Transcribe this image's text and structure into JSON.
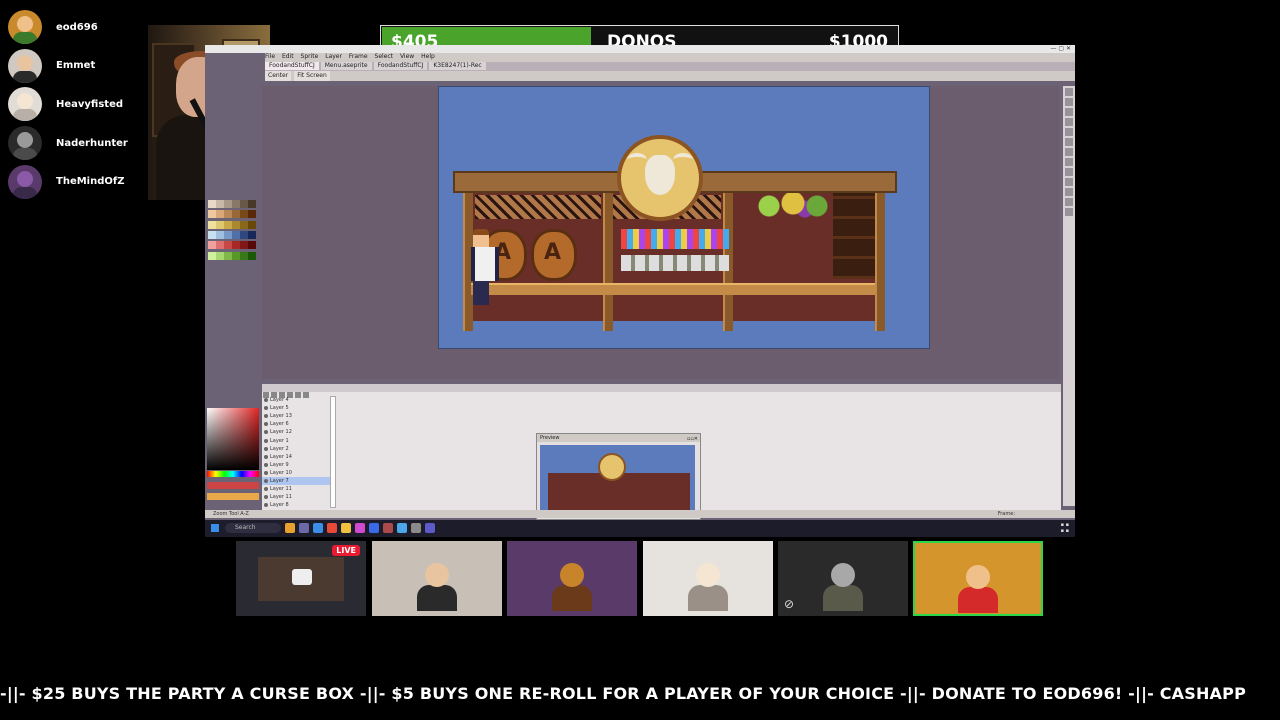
{
  "participants": [
    {
      "name": "eod696",
      "avatar": "avatar-eod696",
      "color": "#c88a2c",
      "face": "#f0c08a",
      "body": "#3a7a2a"
    },
    {
      "name": "Emmet",
      "avatar": "avatar-emmet",
      "color": "#cfc9c2",
      "face": "#e8c4a0",
      "body": "#2a2a2a"
    },
    {
      "name": "Heavyfisted",
      "avatar": "avatar-heavyfisted",
      "color": "#e2dcd6",
      "face": "#f4e6d2",
      "body": "#b8b0a8"
    },
    {
      "name": "Naderhunter",
      "avatar": "avatar-naderhunter",
      "color": "#2a2a2a",
      "face": "#9a9a9a",
      "body": "#4a4a4a"
    },
    {
      "name": "TheMindOfZ",
      "avatar": "avatar-themindofz",
      "color": "#5a3a6a",
      "face": "#8a5aa8",
      "body": "#3a2a4a"
    }
  ],
  "donations": {
    "current": "$405",
    "label": "DONOS",
    "goal": "$1000",
    "progress": 0.405,
    "fill_color": "#4aa32a"
  },
  "aseprite": {
    "tabs": [
      {
        "label": "FoodandStuffCJ"
      },
      {
        "label": "Menu.aseprite"
      },
      {
        "label": "FoodandStuffCJ"
      },
      {
        "label": "K3E8247(1)-Rec"
      }
    ],
    "toolbar": [
      "Center",
      "Fit Screen"
    ],
    "layers": [
      "Layer 4",
      "Layer 5",
      "Layer 13",
      "Layer 6",
      "Layer 12",
      "Layer 1",
      "Layer 2",
      "Layer 14",
      "Layer 9",
      "Layer 10",
      "Layer 7",
      "Layer 11",
      "Layer 11",
      "Layer 8"
    ],
    "preview_title": "Preview",
    "status_zoom": "Zoom Tool A-Z",
    "frame_label": "Frame:",
    "search_label": "Search"
  },
  "tiles": [
    {
      "id": "streamer-preview",
      "bg": "#2a2a32",
      "live": "LIVE"
    },
    {
      "id": "emmet",
      "bg": "#c8c0b6",
      "head": "#e8c4a0",
      "body": "#2a2a2a"
    },
    {
      "id": "themindofz",
      "bg": "#5a3a68",
      "head": "#c8842a",
      "body": "#6a3a1a"
    },
    {
      "id": "heavyfisted",
      "bg": "#e6e2de",
      "head": "#f4e6d2",
      "body": "#9a9088"
    },
    {
      "id": "naderhunter",
      "bg": "#2a2a2a",
      "head": "#a8a8a8",
      "body": "#5a5a4a",
      "mute": "⊘"
    },
    {
      "id": "eod696",
      "bg": "#d4962c",
      "head": "#f0c08a",
      "body": "#d42a2a"
    }
  ],
  "ticker": "-||- $25 BUYS THE PARTY A CURSE BOX -||- $5 BUYS ONE RE-ROLL FOR A PLAYER OF YOUR CHOICE -||-  DONATE TO EOD696! -||- CASHAPP"
}
